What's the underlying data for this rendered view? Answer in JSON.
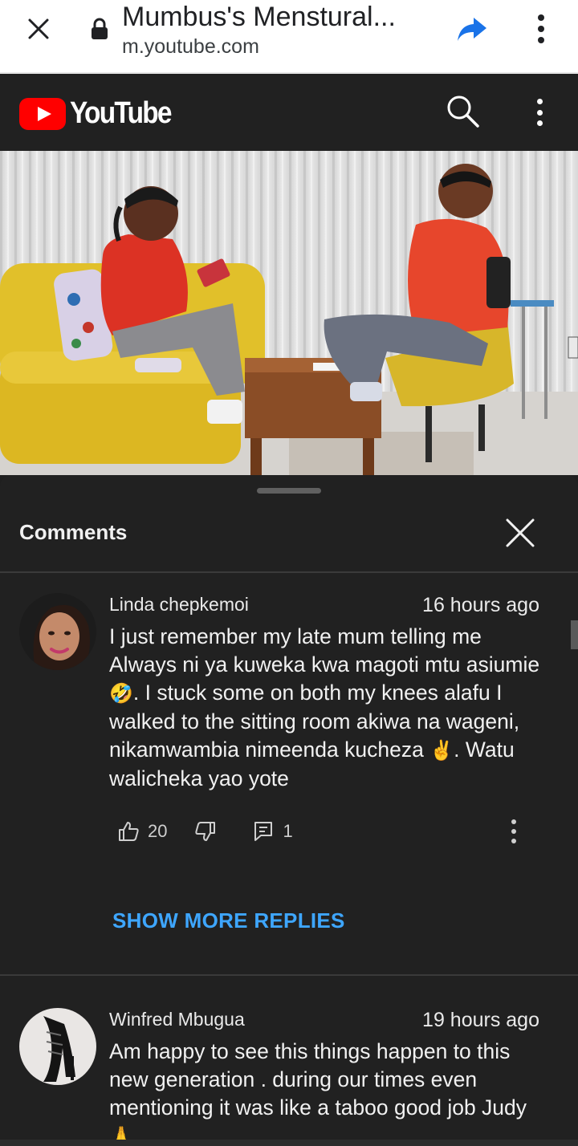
{
  "tab": {
    "title": "Mumbus's Menstural...",
    "url": "m.youtube.com"
  },
  "youtube": {
    "logo_text": "YouTube"
  },
  "comments_panel": {
    "title": "Comments",
    "show_more_replies": "SHOW MORE REPLIES"
  },
  "comments": [
    {
      "author": "Linda chepkemoi",
      "time": "16 hours ago",
      "text_1": "I just remember my late mum telling me Always ni ya kuweka kwa magoti mtu asiumie",
      "emoji_1": "🤣",
      "text_2": ". I stuck some on both my knees alafu I walked to the sitting room akiwa na wageni, nikamwambia nimeenda kucheza",
      "emoji_2": "✌️",
      "text_3": ". Watu walicheka yao yote",
      "likes": "20",
      "replies": "1"
    },
    {
      "author": "Winfred Mbugua",
      "time": "19 hours ago",
      "text_1": "Am happy to see this things happen to this new generation . during our times even mentioning it was like a taboo good job Judy",
      "emoji_1": "🙏"
    }
  ],
  "colors": {
    "accent_link": "#3ea6ff",
    "youtube_red": "#ff0000",
    "panel_bg": "#212121"
  },
  "icons": [
    "close-icon",
    "lock-icon",
    "share-icon",
    "more-vert-icon",
    "search-icon",
    "thumb-up-icon",
    "thumb-down-icon",
    "reply-icon"
  ]
}
